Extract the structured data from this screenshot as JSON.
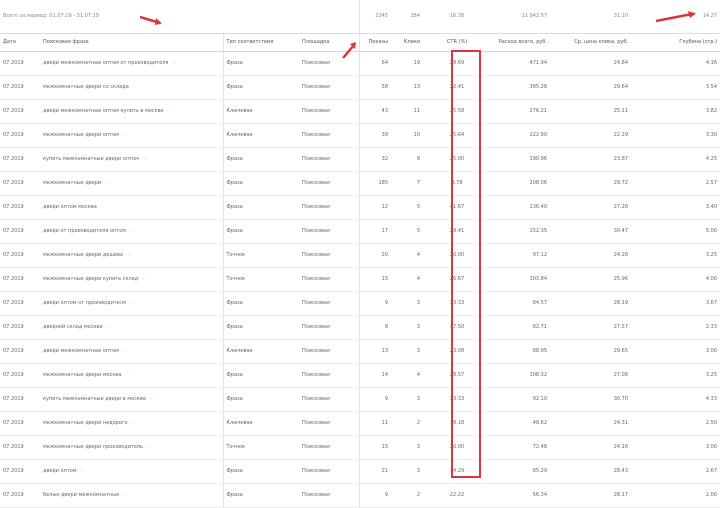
{
  "summary": {
    "label": "Всего за период: 01.07.19 - 31.07.19",
    "shows": "2345",
    "clicks": "384",
    "ctr": "16.38",
    "spend": "11 942.57",
    "avg_cpc": "31.10",
    "conversions": "14.27"
  },
  "columns": {
    "date": "Дата",
    "phrase": "Поисковая фраза",
    "match_type": "Тип соответствия",
    "placement": "Площадка",
    "shows": "Показы",
    "clicks": "Клики",
    "ctr": "CTR (%)",
    "spend": "Расход всего, руб.",
    "avg_cpc": "Ср. цена клика, руб.",
    "depth": "Глубина (стр.)"
  },
  "rows": [
    {
      "date": "07.2019",
      "phrase": "двери межкомнатные оптом от производителя",
      "match_type": "Фраза",
      "placement": "Поисковая",
      "shows": "64",
      "clicks": "19",
      "ctr": "29.69",
      "spend": "471.94",
      "avg_cpc": "24.84",
      "depth": "4.16"
    },
    {
      "date": "07.2019",
      "phrase": "межкомнатные двери со склада",
      "match_type": "Фраза",
      "placement": "Поисковая",
      "shows": "58",
      "clicks": "13",
      "ctr": "22.41",
      "spend": "385.28",
      "avg_cpc": "29.64",
      "depth": "3.54"
    },
    {
      "date": "07.2019",
      "phrase": "двери межкомнатные оптом купить в москве",
      "match_type": "Ключевая",
      "placement": "Поисковая",
      "shows": "43",
      "clicks": "11",
      "ctr": "25.58",
      "spend": "276.21",
      "avg_cpc": "25.11",
      "depth": "3.82"
    },
    {
      "date": "07.2019",
      "phrase": "межкомнатные двери оптом",
      "match_type": "Ключевая",
      "placement": "Поисковая",
      "shows": "39",
      "clicks": "10",
      "ctr": "25.64",
      "spend": "222.90",
      "avg_cpc": "22.29",
      "depth": "3.30"
    },
    {
      "date": "07.2019",
      "phrase": "купить межкомнатные двери оптом",
      "match_type": "Фраза",
      "placement": "Поисковая",
      "shows": "32",
      "clicks": "8",
      "ctr": "25.00",
      "spend": "190.96",
      "avg_cpc": "23.87",
      "depth": "4.25"
    },
    {
      "date": "07.2019",
      "phrase": "межкомнатные двери",
      "match_type": "Фраза",
      "placement": "Поисковая",
      "shows": "185",
      "clicks": "7",
      "ctr": "3.78",
      "spend": "208.06",
      "avg_cpc": "29.72",
      "depth": "2.57"
    },
    {
      "date": "07.2019",
      "phrase": "двери оптом москва",
      "match_type": "Фраза",
      "placement": "Поисковая",
      "shows": "12",
      "clicks": "5",
      "ctr": "41.67",
      "spend": "136.40",
      "avg_cpc": "27.28",
      "depth": "3.40"
    },
    {
      "date": "07.2019",
      "phrase": "двери от производителя оптом",
      "match_type": "Фраза",
      "placement": "Поисковая",
      "shows": "17",
      "clicks": "5",
      "ctr": "29.41",
      "spend": "152.35",
      "avg_cpc": "30.47",
      "depth": "5.00"
    },
    {
      "date": "07.2019",
      "phrase": "межкомнатные двери дешево",
      "match_type": "Точное",
      "placement": "Поисковая",
      "shows": "20",
      "clicks": "4",
      "ctr": "20.00",
      "spend": "97.12",
      "avg_cpc": "24.28",
      "depth": "3.25"
    },
    {
      "date": "07.2019",
      "phrase": "межкомнатные двери купить склад",
      "match_type": "Точное",
      "placement": "Поисковая",
      "shows": "15",
      "clicks": "4",
      "ctr": "26.67",
      "spend": "103.84",
      "avg_cpc": "25.96",
      "depth": "4.00"
    },
    {
      "date": "07.2019",
      "phrase": "двери оптом от производителя",
      "match_type": "Фраза",
      "placement": "Поисковая",
      "shows": "9",
      "clicks": "3",
      "ctr": "33.33",
      "spend": "84.57",
      "avg_cpc": "28.19",
      "depth": "3.67"
    },
    {
      "date": "07.2019",
      "phrase": "дверной склад москва",
      "match_type": "Фраза",
      "placement": "Поисковая",
      "shows": "8",
      "clicks": "3",
      "ctr": "37.50",
      "spend": "82.71",
      "avg_cpc": "27.57",
      "depth": "2.33"
    },
    {
      "date": "07.2019",
      "phrase": "двери межкомнатные оптом",
      "match_type": "Ключевая",
      "placement": "Поисковая",
      "shows": "13",
      "clicks": "3",
      "ctr": "23.08",
      "spend": "88.95",
      "avg_cpc": "29.65",
      "depth": "3.00"
    },
    {
      "date": "07.2019",
      "phrase": "межкомнатные двери москва",
      "match_type": "Фраза",
      "placement": "Поисковая",
      "shows": "14",
      "clicks": "4",
      "ctr": "28.57",
      "spend": "108.32",
      "avg_cpc": "27.08",
      "depth": "3.25"
    },
    {
      "date": "07.2019",
      "phrase": "купить межкомнатные двери в москве",
      "match_type": "Фраза",
      "placement": "Поисковая",
      "shows": "9",
      "clicks": "3",
      "ctr": "33.33",
      "spend": "92.10",
      "avg_cpc": "30.70",
      "depth": "4.33"
    },
    {
      "date": "07.2019",
      "phrase": "межкомнатные двери недорого",
      "match_type": "Ключевая",
      "placement": "Поисковая",
      "shows": "11",
      "clicks": "2",
      "ctr": "18.18",
      "spend": "48.62",
      "avg_cpc": "24.31",
      "depth": "2.50"
    },
    {
      "date": "07.2019",
      "phrase": "межкомнатные двери производитель",
      "match_type": "Точное",
      "placement": "Поисковая",
      "shows": "15",
      "clicks": "3",
      "ctr": "20.00",
      "spend": "72.48",
      "avg_cpc": "24.16",
      "depth": "3.00"
    },
    {
      "date": "07.2019",
      "phrase": "двери оптом",
      "match_type": "Фраза",
      "placement": "Поисковая",
      "shows": "21",
      "clicks": "3",
      "ctr": "14.29",
      "spend": "85.29",
      "avg_cpc": "28.43",
      "depth": "2.67"
    },
    {
      "date": "07.2019",
      "phrase": "белые двери межкомнатные",
      "match_type": "Фраза",
      "placement": "Поисковая",
      "shows": "9",
      "clicks": "2",
      "ctr": "22.22",
      "spend": "56.34",
      "avg_cpc": "28.17",
      "depth": "2.00"
    }
  ],
  "accent_color": "#d9363e"
}
